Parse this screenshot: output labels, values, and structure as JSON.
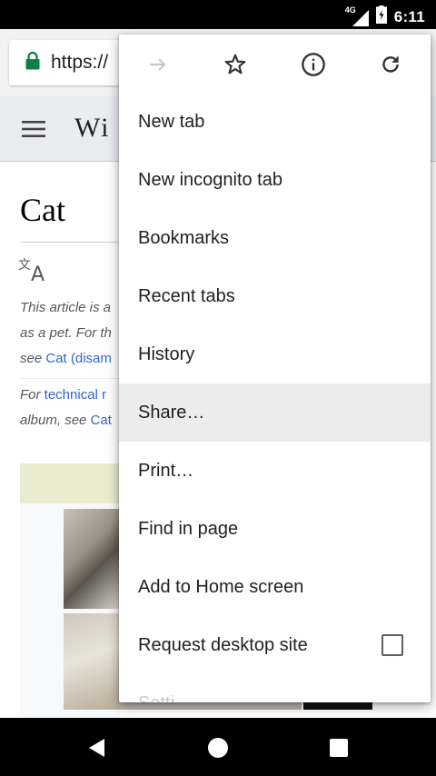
{
  "status_bar": {
    "time": "6:11",
    "network": "4G"
  },
  "browser": {
    "url": "https://"
  },
  "wiki": {
    "logo": "Wi",
    "title": "Cat",
    "hatnote1": [
      "This article is a",
      "as a pet. For th",
      "see "
    ],
    "hatnote1_link": "Cat (disam",
    "hatnote2_prefix": "For ",
    "hatnote2_link1": "technical r",
    "hatnote2_line2_prefix": "album, see ",
    "hatnote2_link2": "Cat"
  },
  "menu": {
    "icons": [
      "forward-icon",
      "star-icon",
      "info-icon",
      "refresh-icon"
    ],
    "items": [
      {
        "label": "New tab"
      },
      {
        "label": "New incognito tab"
      },
      {
        "label": "Bookmarks"
      },
      {
        "label": "Recent tabs"
      },
      {
        "label": "History"
      },
      {
        "label": "Share…",
        "highlighted": true
      },
      {
        "label": "Print…"
      },
      {
        "label": "Find in page"
      },
      {
        "label": "Add to Home screen"
      },
      {
        "label": "Request desktop site",
        "checkbox_checked": false
      },
      {
        "label": "Setti"
      }
    ]
  },
  "colors": {
    "lock_green": "#0b8043",
    "link_blue": "#3366cc",
    "highlight": "#ececec"
  }
}
